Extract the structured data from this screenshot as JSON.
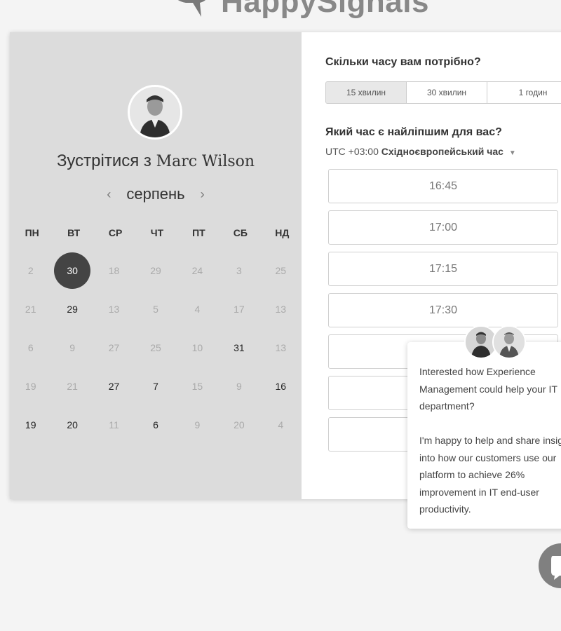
{
  "brand": {
    "name": "HappySignals"
  },
  "host": {
    "prefix": "Зустрітися з",
    "name": "Marc Wilson"
  },
  "calendar": {
    "month": "серпень",
    "weekdays": [
      "ПН",
      "ВТ",
      "СР",
      "ЧТ",
      "ПТ",
      "СБ",
      "НД"
    ],
    "days": [
      {
        "label": "2",
        "enabled": false
      },
      {
        "label": "30",
        "enabled": true,
        "selected": true
      },
      {
        "label": "18",
        "enabled": false
      },
      {
        "label": "29",
        "enabled": false
      },
      {
        "label": "24",
        "enabled": false
      },
      {
        "label": "3",
        "enabled": false
      },
      {
        "label": "25",
        "enabled": false
      },
      {
        "label": "21",
        "enabled": false
      },
      {
        "label": "29",
        "enabled": true
      },
      {
        "label": "13",
        "enabled": false
      },
      {
        "label": "5",
        "enabled": false
      },
      {
        "label": "4",
        "enabled": false
      },
      {
        "label": "17",
        "enabled": false
      },
      {
        "label": "13",
        "enabled": false
      },
      {
        "label": "6",
        "enabled": false
      },
      {
        "label": "9",
        "enabled": false
      },
      {
        "label": "27",
        "enabled": false
      },
      {
        "label": "25",
        "enabled": false
      },
      {
        "label": "10",
        "enabled": false
      },
      {
        "label": "31",
        "enabled": true
      },
      {
        "label": "13",
        "enabled": false
      },
      {
        "label": "19",
        "enabled": false
      },
      {
        "label": "21",
        "enabled": false
      },
      {
        "label": "27",
        "enabled": true
      },
      {
        "label": "7",
        "enabled": true
      },
      {
        "label": "15",
        "enabled": false
      },
      {
        "label": "9",
        "enabled": false
      },
      {
        "label": "16",
        "enabled": true
      },
      {
        "label": "19",
        "enabled": true
      },
      {
        "label": "20",
        "enabled": true
      },
      {
        "label": "11",
        "enabled": false
      },
      {
        "label": "6",
        "enabled": true
      },
      {
        "label": "9",
        "enabled": false
      },
      {
        "label": "20",
        "enabled": false
      },
      {
        "label": "4",
        "enabled": false
      }
    ]
  },
  "duration": {
    "question": "Скільки часу вам потрібно?",
    "options": [
      "15 хвилин",
      "30 хвилин",
      "1 годин"
    ],
    "selected_index": 0
  },
  "time": {
    "question": "Який час є найліпшим для вас?",
    "tz_offset": "UTC +03:00",
    "tz_name": "Східноєвропейський час",
    "slots": [
      "16:45",
      "17:00",
      "17:15",
      "17:30",
      "",
      "",
      ""
    ]
  },
  "chat": {
    "paragraphs": [
      "Interested how Experience Management could help your IT department?",
      "I'm happy to help and share insight into how our customers use our platform to achieve 26% improvement in IT end-user productivity."
    ]
  }
}
